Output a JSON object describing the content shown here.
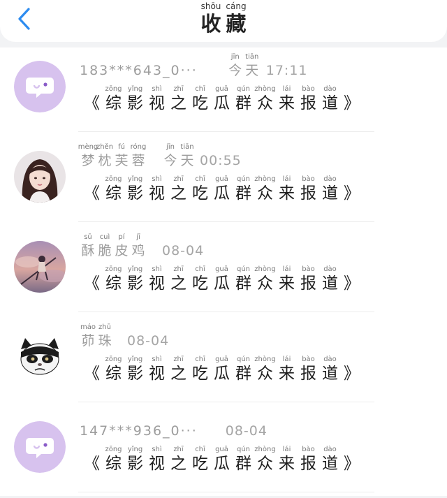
{
  "header": {
    "title": [
      {
        "py": "shōu",
        "hz": "收"
      },
      {
        "py": "cáng",
        "hz": "藏"
      }
    ]
  },
  "caption": [
    {
      "py": "zōng",
      "hz": "综"
    },
    {
      "py": "yǐng",
      "hz": "影"
    },
    {
      "py": "shì",
      "hz": "视"
    },
    {
      "py": "zhī",
      "hz": "之"
    },
    {
      "py": "chī",
      "hz": "吃"
    },
    {
      "py": "guā",
      "hz": "瓜"
    },
    {
      "py": "qún",
      "hz": "群"
    },
    {
      "py": "zhòng",
      "hz": "众"
    },
    {
      "py": "lái",
      "hz": "来"
    },
    {
      "py": "bào",
      "hz": "报"
    },
    {
      "py": "dào",
      "hz": "道"
    }
  ],
  "brackets": {
    "open": "《",
    "close": "》"
  },
  "items": [
    {
      "name": "183***643_0···",
      "time_py": [
        {
          "py": "jīn",
          "hz": "今"
        },
        {
          "py": "tiān",
          "hz": "天"
        }
      ],
      "time": "17:11",
      "avatar": "chat-bubble-icon"
    },
    {
      "name_py": [
        {
          "py": "mèng",
          "hz": "梦"
        },
        {
          "py": "zhěn",
          "hz": "枕"
        },
        {
          "py": "fú",
          "hz": "芙"
        },
        {
          "py": "róng",
          "hz": "蓉"
        }
      ],
      "time_py": [
        {
          "py": "jīn",
          "hz": "今"
        },
        {
          "py": "tiān",
          "hz": "天"
        }
      ],
      "time": "00:55",
      "avatar": "girl-portrait"
    },
    {
      "name_py": [
        {
          "py": "sū",
          "hz": "酥"
        },
        {
          "py": "cuì",
          "hz": "脆"
        },
        {
          "py": "pí",
          "hz": "皮"
        },
        {
          "py": "jī",
          "hz": "鸡"
        }
      ],
      "time": "08-04",
      "avatar": "anime-scene"
    },
    {
      "name_py": [
        {
          "py": "máo",
          "hz": "茆"
        },
        {
          "py": "zhū",
          "hz": "珠"
        }
      ],
      "time": "08-04",
      "avatar": "panda-cat"
    },
    {
      "name": "147***936_0···",
      "time": "08-04",
      "avatar": "chat-bubble-icon"
    }
  ]
}
